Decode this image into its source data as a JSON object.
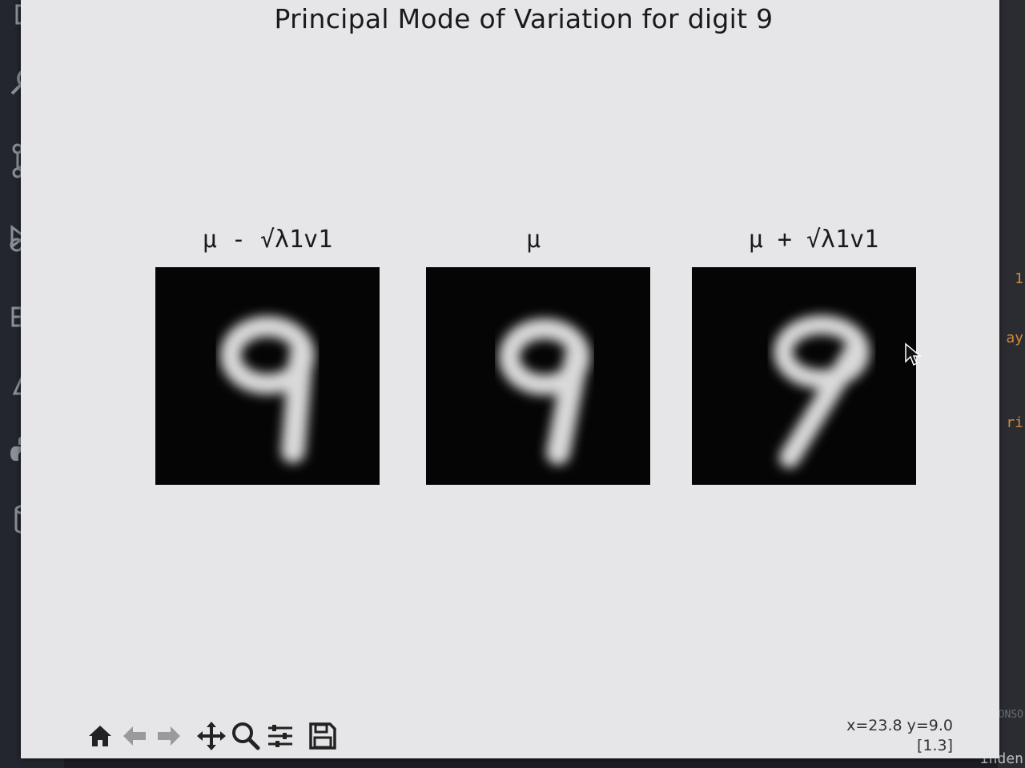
{
  "figure": {
    "title": "Principal Mode of Variation for digit 9",
    "subplots": [
      {
        "title": "μ - √λ1v1",
        "variant": "minus"
      },
      {
        "title": "μ",
        "variant": "mean"
      },
      {
        "title": "μ + √λ1v1",
        "variant": "plus"
      }
    ]
  },
  "toolbar": {
    "buttons": [
      "home-icon",
      "back-arrow-icon",
      "forward-arrow-icon",
      "pan-icon",
      "zoom-icon",
      "configure-subplots-icon",
      "save-icon"
    ]
  },
  "status": {
    "coordinates": "x=23.8 y=9.0",
    "pixel_value": "[1.3]"
  },
  "colors": {
    "figure_background": "#e6e6e8",
    "axes_background": "#050505",
    "digit_stroke": "#d9d9d9",
    "activity_bar": "#23262d",
    "accent_blue": "#3c8ae6"
  },
  "editor_fragments": {
    "frag1": "1",
    "frag2": "ay",
    "frag3": "ri",
    "frag4": "CONSO",
    "frag5": "inden"
  }
}
